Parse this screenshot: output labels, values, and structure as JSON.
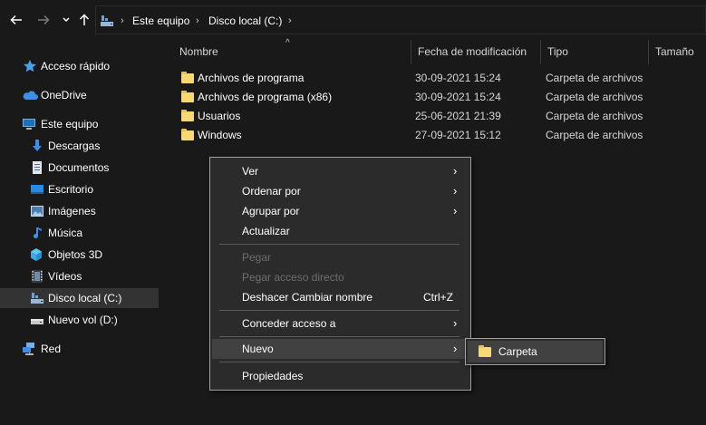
{
  "toolbar": {
    "back_icon": "arrow-left-icon",
    "forward_icon": "arrow-right-icon",
    "recent_icon": "chevron-down-icon",
    "up_icon": "arrow-up-icon"
  },
  "address": {
    "segments": [
      "Este equipo",
      "Disco local (C:)"
    ]
  },
  "nav": {
    "items": [
      {
        "label": "Acceso rápido",
        "icon": "star-icon"
      },
      {
        "label": "OneDrive",
        "icon": "cloud-icon"
      },
      {
        "label": "Este equipo",
        "icon": "computer-icon"
      },
      {
        "label": "Descargas",
        "icon": "download-icon"
      },
      {
        "label": "Documentos",
        "icon": "document-icon"
      },
      {
        "label": "Escritorio",
        "icon": "desktop-icon"
      },
      {
        "label": "Imágenes",
        "icon": "pictures-icon"
      },
      {
        "label": "Música",
        "icon": "music-icon"
      },
      {
        "label": "Objetos 3D",
        "icon": "cube-icon"
      },
      {
        "label": "Vídeos",
        "icon": "video-icon"
      },
      {
        "label": "Disco local (C:)",
        "icon": "drive-c-icon"
      },
      {
        "label": "Nuevo vol (D:)",
        "icon": "drive-icon"
      },
      {
        "label": "Red",
        "icon": "network-icon"
      }
    ]
  },
  "columns": {
    "name": "Nombre",
    "date": "Fecha de modificación",
    "type": "Tipo",
    "size": "Tamaño"
  },
  "files": [
    {
      "name": "Archivos de programa",
      "date": "30-09-2021 15:24",
      "type": "Carpeta de archivos"
    },
    {
      "name": "Archivos de programa (x86)",
      "date": "30-09-2021 15:24",
      "type": "Carpeta de archivos"
    },
    {
      "name": "Usuarios",
      "date": "25-06-2021 21:39",
      "type": "Carpeta de archivos"
    },
    {
      "name": "Windows",
      "date": "27-09-2021 15:12",
      "type": "Carpeta de archivos"
    }
  ],
  "context_menu": {
    "view": "Ver",
    "sort_by": "Ordenar por",
    "group_by": "Agrupar por",
    "refresh": "Actualizar",
    "paste": "Pegar",
    "paste_shortcut": "Pegar acceso directo",
    "undo_rename": "Deshacer Cambiar nombre",
    "undo_key": "Ctrl+Z",
    "give_access": "Conceder acceso a",
    "new": "Nuevo",
    "properties": "Propiedades"
  },
  "submenu": {
    "folder": "Carpeta"
  }
}
